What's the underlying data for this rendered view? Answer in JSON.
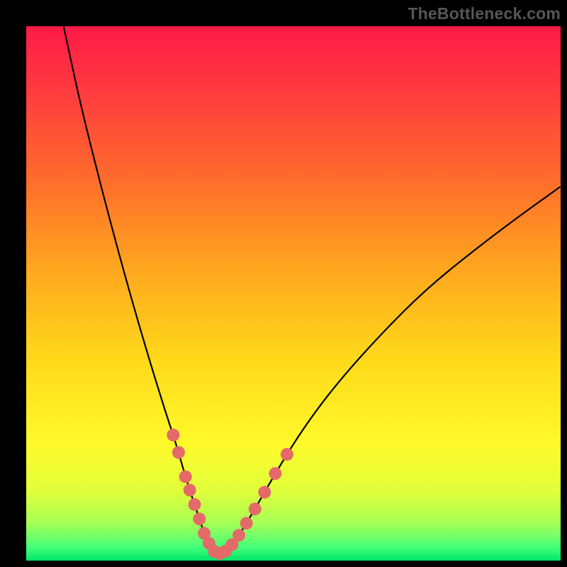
{
  "watermark": "TheBottleneck.com",
  "chart_data": {
    "type": "line",
    "title": "",
    "xlabel": "",
    "ylabel": "",
    "xlim": [
      0,
      100
    ],
    "ylim": [
      0,
      100
    ],
    "description": "V-shaped bottleneck curve over a vertical rainbow gradient (red top → green bottom). Minimum of the curve occurs near x≈35, y≈0. Left branch rises steeply to y=100 at x≈7; right branch rises more gradually to y≈70 at x=100.",
    "curve": {
      "x": [
        7,
        10,
        14,
        18,
        22,
        26,
        28,
        30,
        32,
        33.5,
        35,
        36.5,
        38,
        40,
        43,
        47,
        52,
        58,
        66,
        75,
        85,
        93,
        100
      ],
      "y": [
        100,
        86,
        70,
        55,
        41,
        28,
        22,
        15,
        9,
        4.5,
        1.8,
        1.2,
        2.3,
        5,
        10,
        17,
        25,
        33,
        42,
        51,
        59,
        65,
        70
      ]
    },
    "markers_on_curve_x": [
      27.5,
      28.5,
      29.8,
      30.6,
      31.5,
      32.4,
      33.3,
      34.2,
      35.2,
      36.2,
      37.3,
      38.5,
      39.8,
      41.2,
      42.8,
      44.6,
      46.6,
      48.8
    ],
    "marker_color": "#e46a6a",
    "marker_radius": 9,
    "gradient_stops": [
      {
        "offset": 0.0,
        "color": "#ff1a47"
      },
      {
        "offset": 0.12,
        "color": "#ff3a3f"
      },
      {
        "offset": 0.28,
        "color": "#ff6a2c"
      },
      {
        "offset": 0.45,
        "color": "#ffa51f"
      },
      {
        "offset": 0.62,
        "color": "#ffd81a"
      },
      {
        "offset": 0.78,
        "color": "#fff92a"
      },
      {
        "offset": 0.87,
        "color": "#e0ff3a"
      },
      {
        "offset": 0.93,
        "color": "#a6ff55"
      },
      {
        "offset": 0.975,
        "color": "#45ff7a"
      },
      {
        "offset": 1.0,
        "color": "#00e56a"
      }
    ]
  }
}
